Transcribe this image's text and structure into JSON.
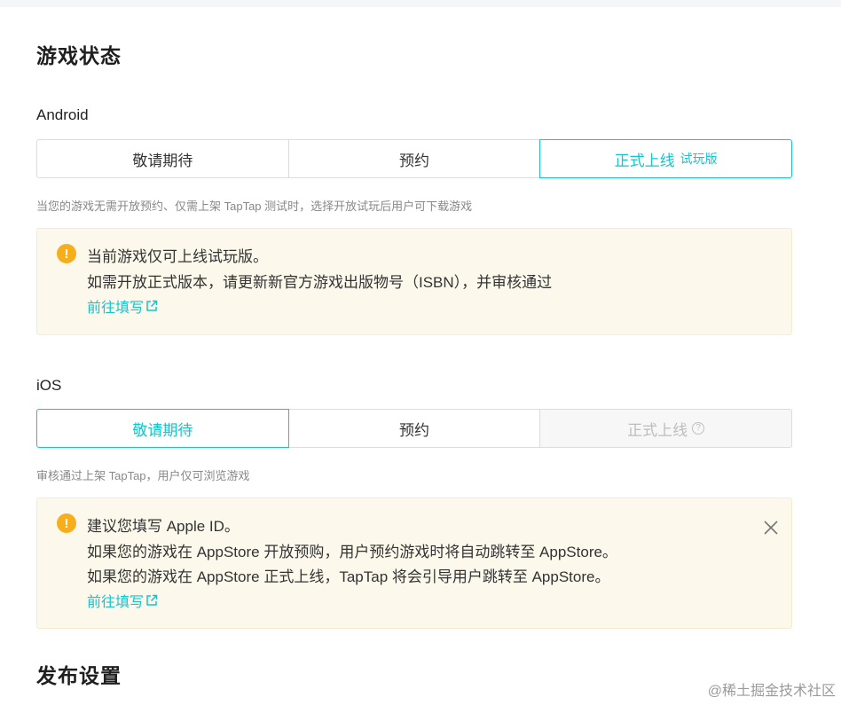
{
  "game_status": {
    "title": "游戏状态",
    "android": {
      "label": "Android",
      "options": [
        "敬请期待",
        "预约",
        "正式上线"
      ],
      "option3_suffix": "试玩版",
      "hint": "当您的游戏无需开放预约、仅需上架 TapTap 测试时，选择开放试玩后用户可下载游戏",
      "alert": {
        "lines": [
          "当前游戏仅可上线试玩版。",
          "如需开放正式版本，请更新新官方游戏出版物号（ISBN），并审核通过"
        ],
        "link": "前往填写"
      }
    },
    "ios": {
      "label": "iOS",
      "options": [
        "敬请期待",
        "预约",
        "正式上线"
      ],
      "hint": "审核通过上架 TapTap，用户仅可浏览游戏",
      "alert": {
        "lines": [
          "建议您填写 Apple ID。",
          "如果您的游戏在 AppStore 开放预购，用户预约游戏时将自动跳转至 AppStore。",
          "如果您的游戏在 AppStore 正式上线，TapTap 将会引导用户跳转至 AppStore。"
        ],
        "link": "前往填写"
      }
    }
  },
  "release_settings": {
    "title": "发布设置"
  },
  "watermark": "@稀土掘金技术社区",
  "colors": {
    "accent": "#15c5ce",
    "warning": "#f7ae1c",
    "alert_bg": "#fdf8ec"
  },
  "icons": {
    "warning": "exclamation-circle-icon",
    "external_link": "external-link-icon",
    "close": "close-icon",
    "help": "question-circle-icon"
  }
}
